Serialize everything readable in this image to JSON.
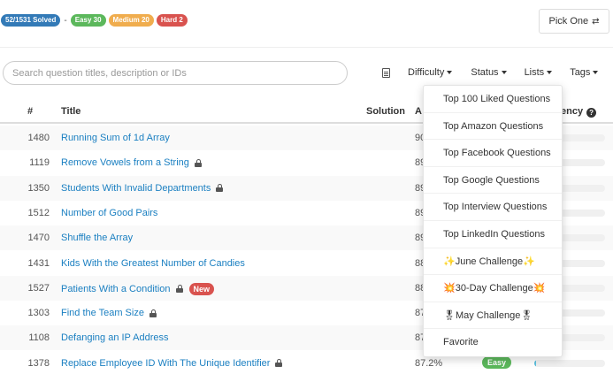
{
  "stats": {
    "solved": "52/1531 Solved",
    "separator": "-",
    "easy": "Easy 30",
    "medium": "Medium 20",
    "hard": "Hard 2"
  },
  "pick_one": {
    "label": "Pick One",
    "icon": "shuffle-icon"
  },
  "search": {
    "placeholder": "Search question titles, description or IDs",
    "value": ""
  },
  "filters": {
    "difficulty": "Difficulty",
    "status": "Status",
    "lists": "Lists",
    "tags": "Tags"
  },
  "table": {
    "headers": {
      "id": "#",
      "title": "Title",
      "solution": "Solution",
      "acceptance": "A",
      "frequency": "ency"
    },
    "rows": [
      {
        "id": "1480",
        "title": "Running Sum of 1d Array",
        "locked": false,
        "new": false,
        "acceptance": "90",
        "difficulty": "",
        "frequency": 0
      },
      {
        "id": "1119",
        "title": "Remove Vowels from a String",
        "locked": true,
        "new": false,
        "acceptance": "89",
        "difficulty": "",
        "frequency": 0
      },
      {
        "id": "1350",
        "title": "Students With Invalid Departments",
        "locked": true,
        "new": false,
        "acceptance": "89",
        "difficulty": "",
        "frequency": 0
      },
      {
        "id": "1512",
        "title": "Number of Good Pairs",
        "locked": false,
        "new": false,
        "acceptance": "89",
        "difficulty": "",
        "frequency": 0
      },
      {
        "id": "1470",
        "title": "Shuffle the Array",
        "locked": false,
        "new": false,
        "acceptance": "89",
        "difficulty": "",
        "frequency": 0
      },
      {
        "id": "1431",
        "title": "Kids With the Greatest Number of Candies",
        "locked": false,
        "new": false,
        "acceptance": "88",
        "difficulty": "",
        "frequency": 0
      },
      {
        "id": "1527",
        "title": "Patients With a Condition",
        "locked": true,
        "new": true,
        "acceptance": "88",
        "difficulty": "",
        "frequency": 0
      },
      {
        "id": "1303",
        "title": "Find the Team Size",
        "locked": true,
        "new": false,
        "acceptance": "87",
        "difficulty": "",
        "frequency": 0
      },
      {
        "id": "1108",
        "title": "Defanging an IP Address",
        "locked": false,
        "new": false,
        "acceptance": "87",
        "difficulty": "",
        "frequency": 0
      },
      {
        "id": "1378",
        "title": "Replace Employee ID With The Unique Identifier",
        "locked": true,
        "new": false,
        "acceptance": "87.2%",
        "difficulty": "Easy",
        "frequency": 0.03
      }
    ],
    "new_label": "New"
  },
  "lists_menu": {
    "items": [
      "Top 100 Liked Questions",
      "Top Amazon Questions",
      "Top Facebook Questions",
      "Top Google Questions",
      "Top Interview Questions",
      "Top LinkedIn Questions",
      "✨June Challenge✨",
      "💥30-Day Challenge💥",
      "🎖May Challenge🎖",
      "Favorite"
    ]
  },
  "colors": {
    "link": "#1a7fc1",
    "easy": "#5cb85c",
    "medium": "#f0ad4e",
    "hard": "#d9534f",
    "solved": "#337ab7",
    "frequency": "#5bc0de"
  }
}
